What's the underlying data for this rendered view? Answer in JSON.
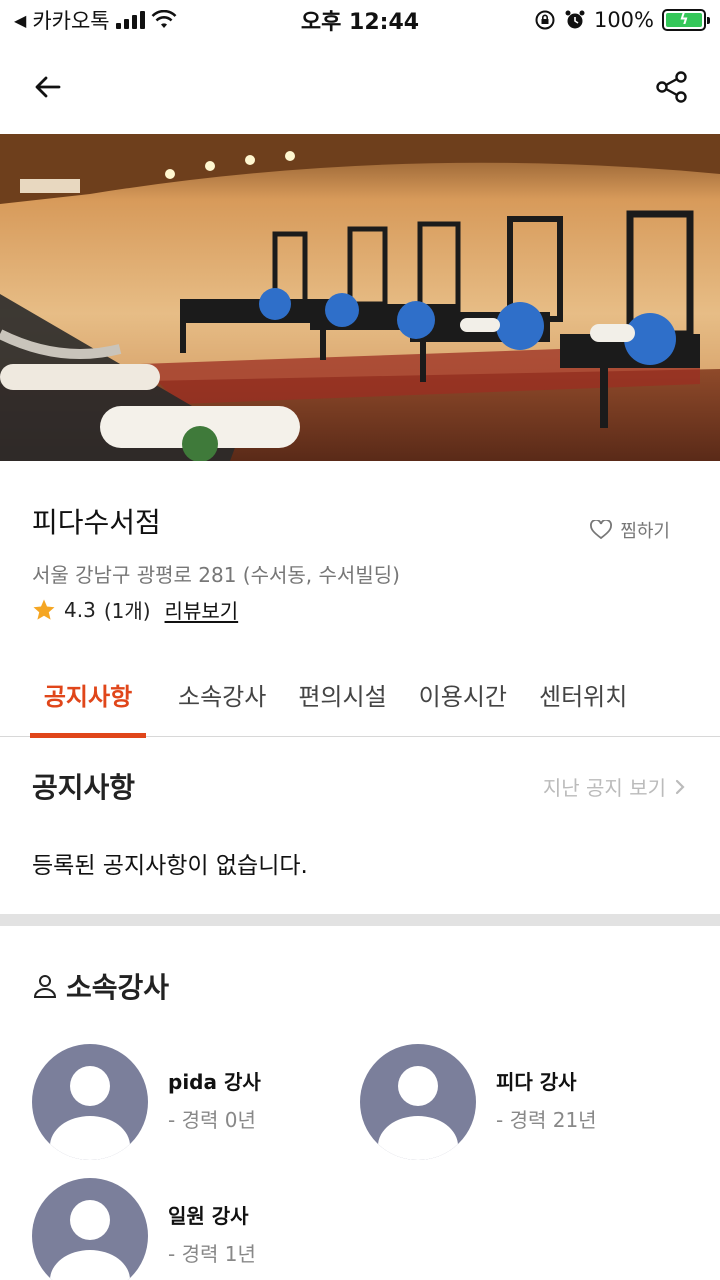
{
  "status_bar": {
    "carrier": "카카오톡",
    "time": "오후 12:44",
    "battery": "100%"
  },
  "top_bar": {
    "back_icon": "arrow-left-icon",
    "share_icon": "share-icon"
  },
  "center": {
    "name": "피다수서점",
    "favorite_label": "찜하기",
    "address": "서울 강남구 광평로 281 (수서동, 수서빌딩)",
    "rating": "4.3",
    "review_count": "(1개)",
    "review_link": "리뷰보기"
  },
  "tabs": [
    {
      "label": "공지사항",
      "active": true
    },
    {
      "label": "소속강사",
      "active": false
    },
    {
      "label": "편의시설",
      "active": false
    },
    {
      "label": "이용시간",
      "active": false
    },
    {
      "label": "센터위치",
      "active": false
    }
  ],
  "notice": {
    "title": "공지사항",
    "more_label": "지난 공지 보기",
    "empty_text": "등록된 공지사항이 없습니다."
  },
  "instructors": {
    "title": "소속강사",
    "items": [
      {
        "name": "pida 강사",
        "career": "- 경력 0년"
      },
      {
        "name": "피다 강사",
        "career": "- 경력 21년"
      },
      {
        "name": "일원 강사",
        "career": "- 경력 1년"
      }
    ]
  },
  "colors": {
    "accent": "#e0461a",
    "star": "#f5a623",
    "avatar": "#7b7f9b"
  }
}
